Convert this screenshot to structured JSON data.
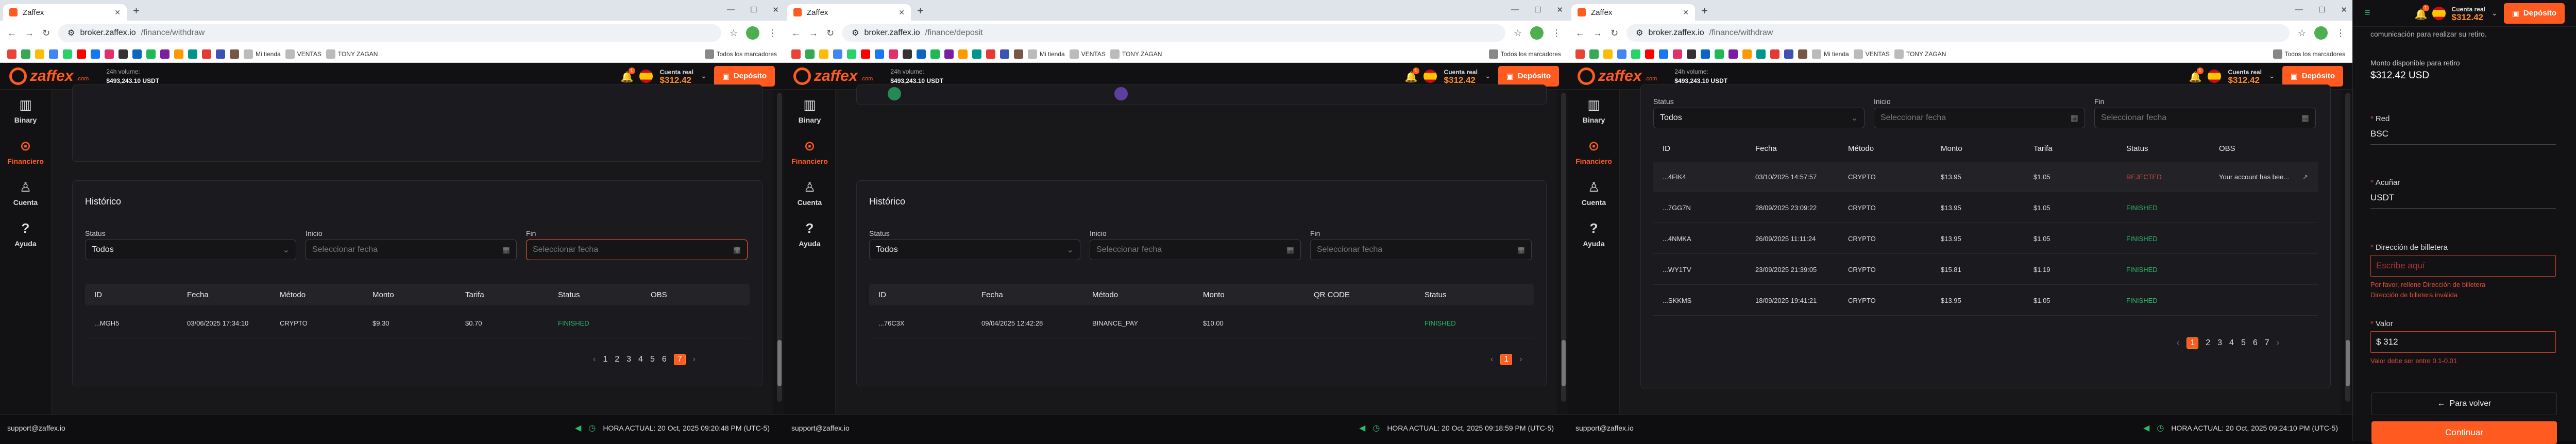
{
  "browser": {
    "tab_title": "Zaffex",
    "windows": [
      {
        "url_host": "broker.zaffex.io",
        "url_path": "/finance/withdraw"
      },
      {
        "url_host": "broker.zaffex.io",
        "url_path": "/finance/deposit"
      },
      {
        "url_host": "broker.zaffex.io",
        "url_path": "/finance/withdraw"
      }
    ],
    "bookmarks": [
      "Todos los marcadores",
      "Mi tienda",
      "VENTAS",
      "TONY ZAGAN"
    ]
  },
  "header": {
    "logo": "zaffex",
    "logo_suffix": ".com",
    "volume_label": "24h volume:",
    "volume_value": "$493,243.10 USDT",
    "account_label": "Cuenta real",
    "account_balance": "$312.42",
    "deposit_label": "Depósito",
    "notif_count": "1"
  },
  "sidebar": {
    "items": [
      "Binary",
      "Financiero",
      "Cuenta",
      "Ayuda"
    ]
  },
  "history": {
    "title": "Histórico",
    "status_label": "Status",
    "status_value": "Todos",
    "start_label": "Inicio",
    "end_label": "Fin",
    "date_placeholder": "Seleccionar fecha"
  },
  "withdraw_table_1": {
    "columns": [
      "ID",
      "Fecha",
      "Método",
      "Monto",
      "Tarifa",
      "Status",
      "OBS"
    ],
    "rows": [
      {
        "id": "...MGH5",
        "fecha": "03/06/2025 17:34:10",
        "metodo": "CRYPTO",
        "monto": "$9.30",
        "tarifa": "$0.70",
        "status": "FINISHED",
        "obs": ""
      }
    ],
    "pages": [
      "1",
      "2",
      "3",
      "4",
      "5",
      "6",
      "7"
    ],
    "current_page": "7"
  },
  "deposit_table": {
    "columns": [
      "ID",
      "Fecha",
      "Método",
      "Monto",
      "QR CODE",
      "Status"
    ],
    "rows": [
      {
        "id": "...76C3X",
        "fecha": "09/04/2025 12:42:28",
        "metodo": "BINANCE_PAY",
        "monto": "$10.00",
        "qr": "",
        "status": "FINISHED"
      }
    ],
    "pages": [
      "1"
    ],
    "current_page": "1"
  },
  "withdraw_table_2": {
    "columns": [
      "ID",
      "Fecha",
      "Método",
      "Monto",
      "Tarifa",
      "Status",
      "OBS"
    ],
    "rows": [
      {
        "id": "...4FIK4",
        "fecha": "03/10/2025 14:57:57",
        "metodo": "CRYPTO",
        "monto": "$13.95",
        "tarifa": "$1.05",
        "status": "REJECTED",
        "obs": "Your account has bee..."
      },
      {
        "id": "...7GG7N",
        "fecha": "28/09/2025 23:09:22",
        "metodo": "CRYPTO",
        "monto": "$13.95",
        "tarifa": "$1.05",
        "status": "FINISHED",
        "obs": ""
      },
      {
        "id": "...4NMKA",
        "fecha": "26/09/2025 11:11:24",
        "metodo": "CRYPTO",
        "monto": "$13.95",
        "tarifa": "$1.05",
        "status": "FINISHED",
        "obs": ""
      },
      {
        "id": "...WY1TV",
        "fecha": "23/09/2025 21:39:05",
        "metodo": "CRYPTO",
        "monto": "$15.81",
        "tarifa": "$1.19",
        "status": "FINISHED",
        "obs": ""
      },
      {
        "id": "...SKKMS",
        "fecha": "18/09/2025 19:41:21",
        "metodo": "CRYPTO",
        "monto": "$13.95",
        "tarifa": "$1.05",
        "status": "FINISHED",
        "obs": ""
      }
    ],
    "pages": [
      "1",
      "2",
      "3",
      "4",
      "5",
      "6",
      "7"
    ],
    "current_page": "1"
  },
  "footer": {
    "support": "support@zaffex.io",
    "times": [
      "HORA ACTUAL: 20 Oct, 2025 09:20:48 PM (UTC-5)",
      "HORA ACTUAL: 20 Oct, 2025 09:18:59 PM (UTC-5)",
      "HORA ACTUAL: 20 Oct, 2025 09:24:10 PM (UTC-5)"
    ]
  },
  "withdraw_panel": {
    "top_text": "comunicación para realizar su retiro.",
    "available_label": "Monto disponible para retiro",
    "available_value": "$312.42 USD",
    "network_label": "Red",
    "network_value": "BSC",
    "currency_label": "Acuñar",
    "currency_value": "USDT",
    "wallet_label": "Dirección de billetera",
    "wallet_placeholder": "Escribe aquí",
    "wallet_error_1": "Por favor, rellene Dirección de billetera",
    "wallet_error_2": "Dirección de billetera inválida",
    "amount_label": "Valor",
    "amount_value": "$ 312",
    "amount_error": "Valor debe ser entre 0.1-0.01",
    "back_label": "Para volver",
    "continue_label": "Continuar"
  },
  "colors": {
    "accent": "#ff5a1f",
    "finished": "#2bb86a",
    "rejected": "#e34b3b"
  }
}
